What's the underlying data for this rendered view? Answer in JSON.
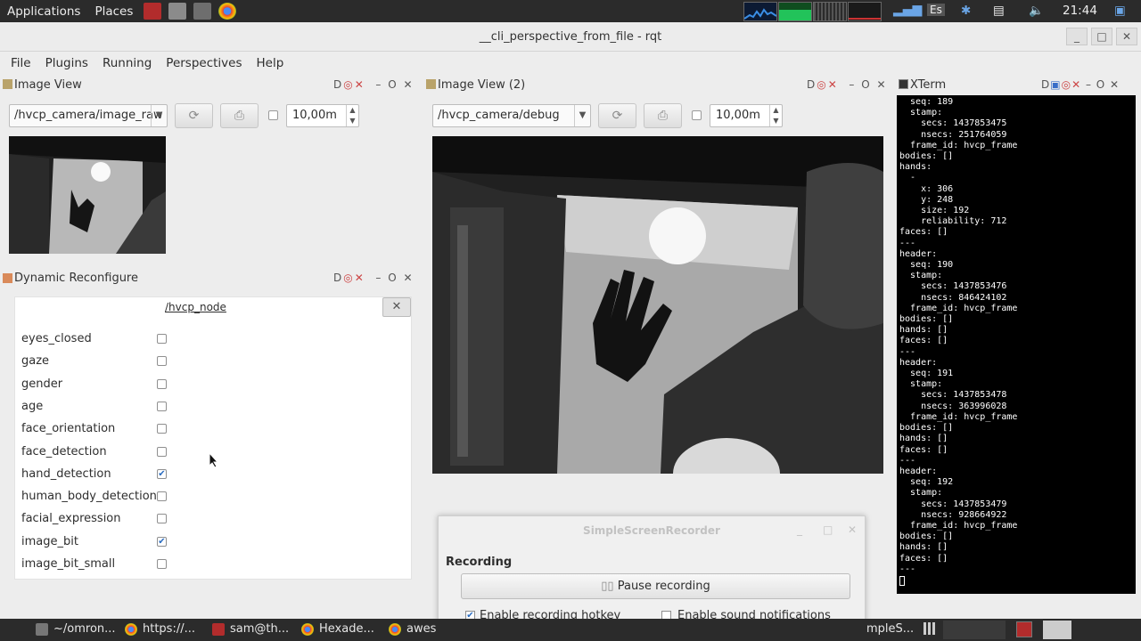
{
  "topbar": {
    "menus": [
      "Applications",
      "Places"
    ],
    "keyboard": "Es",
    "clock": "21:44"
  },
  "window": {
    "title": "__cli_perspective_from_file - rqt",
    "controls": [
      "_",
      "□",
      "✕"
    ]
  },
  "menubar": [
    "File",
    "Plugins",
    "Running",
    "Perspectives",
    "Help"
  ],
  "image_view_1": {
    "title": "Image View",
    "topic": "/hvcp_camera/image_raw",
    "timeout": "10,00m",
    "pane_controls": "D C ✕  – O ✕"
  },
  "image_view_2": {
    "title": "Image View (2)",
    "topic": "/hvcp_camera/debug",
    "timeout": "10,00m"
  },
  "xterm_pane": {
    "title": "XTerm",
    "lines": [
      "  seq: 189",
      "  stamp:",
      "    secs: 1437853475",
      "    nsecs: 251764059",
      "  frame_id: hvcp_frame",
      "bodies: []",
      "hands:",
      "  -",
      "    x: 306",
      "    y: 248",
      "    size: 192",
      "    reliability: 712",
      "faces: []",
      "---",
      "header:",
      "  seq: 190",
      "  stamp:",
      "    secs: 1437853476",
      "    nsecs: 846424102",
      "  frame_id: hvcp_frame",
      "bodies: []",
      "hands: []",
      "faces: []",
      "---",
      "header:",
      "  seq: 191",
      "  stamp:",
      "    secs: 1437853478",
      "    nsecs: 363996028",
      "  frame_id: hvcp_frame",
      "bodies: []",
      "hands: []",
      "faces: []",
      "---",
      "header:",
      "  seq: 192",
      "  stamp:",
      "    secs: 1437853479",
      "    nsecs: 928664922",
      "  frame_id: hvcp_frame",
      "bodies: []",
      "hands: []",
      "faces: []",
      "---"
    ]
  },
  "dynamic_reconfigure": {
    "title": "Dynamic Reconfigure",
    "node": "/hvcp_node",
    "params": [
      {
        "name": "eyes_closed",
        "checked": false
      },
      {
        "name": "gaze",
        "checked": false
      },
      {
        "name": "gender",
        "checked": false
      },
      {
        "name": "age",
        "checked": false
      },
      {
        "name": "face_orientation",
        "checked": false
      },
      {
        "name": "face_detection",
        "checked": false
      },
      {
        "name": "hand_detection",
        "checked": true
      },
      {
        "name": "human_body_detection",
        "checked": false
      },
      {
        "name": "facial_expression",
        "checked": false
      },
      {
        "name": "image_bit",
        "checked": true
      },
      {
        "name": "image_bit_small",
        "checked": false
      }
    ]
  },
  "ssr": {
    "title": "SimpleScreenRecorder",
    "section": "Recording",
    "pause_button": "Pause recording",
    "hotkey_label": "Enable recording hotkey",
    "hotkey_checked": true,
    "sound_label": "Enable sound notifications",
    "sound_checked": false
  },
  "taskbar": {
    "items": [
      "~/omron...",
      "https://...",
      "sam@th...",
      "Hexade...",
      "awes",
      "mpleS..."
    ]
  },
  "colors": {
    "panel_bg": "#ededed",
    "check_blue": "#2a6cc0",
    "terminal_bg": "#000000"
  }
}
